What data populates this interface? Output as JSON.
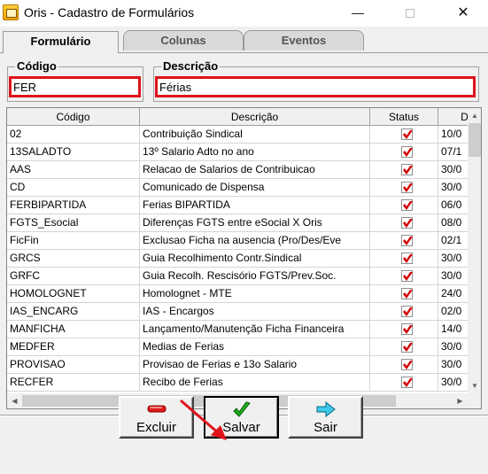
{
  "window": {
    "title": "Oris - Cadastro de Formulários",
    "minimize": "—",
    "close": "✕"
  },
  "tabs": [
    {
      "label": "Formulário",
      "active": true
    },
    {
      "label": "Colunas",
      "active": false
    },
    {
      "label": "Eventos",
      "active": false
    }
  ],
  "filters": {
    "codigo_label": "Código",
    "codigo_value": "FER",
    "descricao_label": "Descrição",
    "descricao_value": "Férias"
  },
  "grid": {
    "columns": [
      "Código",
      "Descrição",
      "Status",
      "D"
    ],
    "rows": [
      {
        "codigo": "02",
        "descricao": "Contribuição Sindical",
        "status": true,
        "data": "10/0"
      },
      {
        "codigo": "13SALADTO",
        "descricao": "13º Salario Adto no ano",
        "status": true,
        "data": "07/1"
      },
      {
        "codigo": "AAS",
        "descricao": "Relacao de Salarios de Contribuicao",
        "status": true,
        "data": "30/0"
      },
      {
        "codigo": "CD",
        "descricao": "Comunicado de Dispensa",
        "status": true,
        "data": "30/0"
      },
      {
        "codigo": "FERBIPARTIDA",
        "descricao": "Ferias BIPARTIDA",
        "status": true,
        "data": "06/0"
      },
      {
        "codigo": "FGTS_Esocial",
        "descricao": "Diferenças FGTS entre eSocial X Oris",
        "status": true,
        "data": "08/0"
      },
      {
        "codigo": "FicFin",
        "descricao": "Exclusao Ficha na ausencia (Pro/Des/Eve",
        "status": true,
        "data": "02/1"
      },
      {
        "codigo": "GRCS",
        "descricao": "Guia Recolhimento Contr.Sindical",
        "status": true,
        "data": "30/0"
      },
      {
        "codigo": "GRFC",
        "descricao": "Guia Recolh. Rescisório FGTS/Prev.Soc.",
        "status": true,
        "data": "30/0"
      },
      {
        "codigo": "HOMOLOGNET",
        "descricao": "Homolognet - MTE",
        "status": true,
        "data": "24/0"
      },
      {
        "codigo": "IAS_ENCARG",
        "descricao": "IAS - Encargos",
        "status": true,
        "data": "02/0"
      },
      {
        "codigo": "MANFICHA",
        "descricao": "Lançamento/Manutenção Ficha Financeira",
        "status": true,
        "data": "14/0"
      },
      {
        "codigo": "MEDFER",
        "descricao": "Medias de Ferias",
        "status": true,
        "data": "30/0"
      },
      {
        "codigo": "PROVISAO",
        "descricao": "Provisao de Ferias e 13o Salario",
        "status": true,
        "data": "30/0"
      },
      {
        "codigo": "RECFER",
        "descricao": "Recibo de Ferias",
        "status": true,
        "data": "30/0"
      }
    ]
  },
  "buttons": {
    "excluir": "Excluir",
    "salvar": "Salvar",
    "sair": "Sair"
  },
  "colors": {
    "highlight": "#e0121b",
    "check": "#d40000"
  },
  "icons": [
    "app-icon",
    "checkmark-icon",
    "delete-minus-icon",
    "save-check-icon",
    "exit-arrow-icon"
  ]
}
